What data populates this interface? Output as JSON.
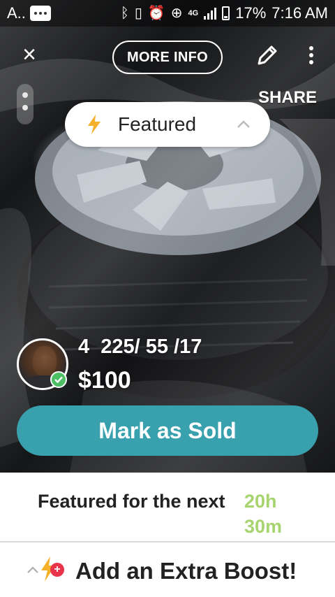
{
  "status_bar": {
    "carrier": "A..",
    "battery_percent": "17%",
    "time": "7:16 AM",
    "network": "4G",
    "icons": [
      "message-icon",
      "bluetooth-icon",
      "vibrate-icon",
      "alarm-icon",
      "data-saver-icon",
      "signal-icon",
      "battery-icon"
    ]
  },
  "top_bar": {
    "close_icon": "close-icon",
    "more_info_label": "MORE INFO",
    "edit_icon": "pencil-icon",
    "overflow_icon": "more-vertical-icon",
    "share_label": "SHARE"
  },
  "featured_pill": {
    "label": "Featured",
    "icon": "lightning-bolt-icon",
    "accent_color": "#f5b12a"
  },
  "listing": {
    "title": "4  225/ 55 /17",
    "price": "$100",
    "seller_verified": true
  },
  "actions": {
    "mark_sold_label": "Mark as Sold",
    "button_color": "#39a1ae"
  },
  "featured_timer": {
    "label": "Featured for the next",
    "hours": "20h",
    "minutes": "30m",
    "accent_color": "#a7d46f"
  },
  "boost": {
    "label": "Add an Extra Boost!",
    "plus_symbol": "+",
    "icons": [
      "chevron-up-icon",
      "lightning-bolt-icon"
    ]
  }
}
